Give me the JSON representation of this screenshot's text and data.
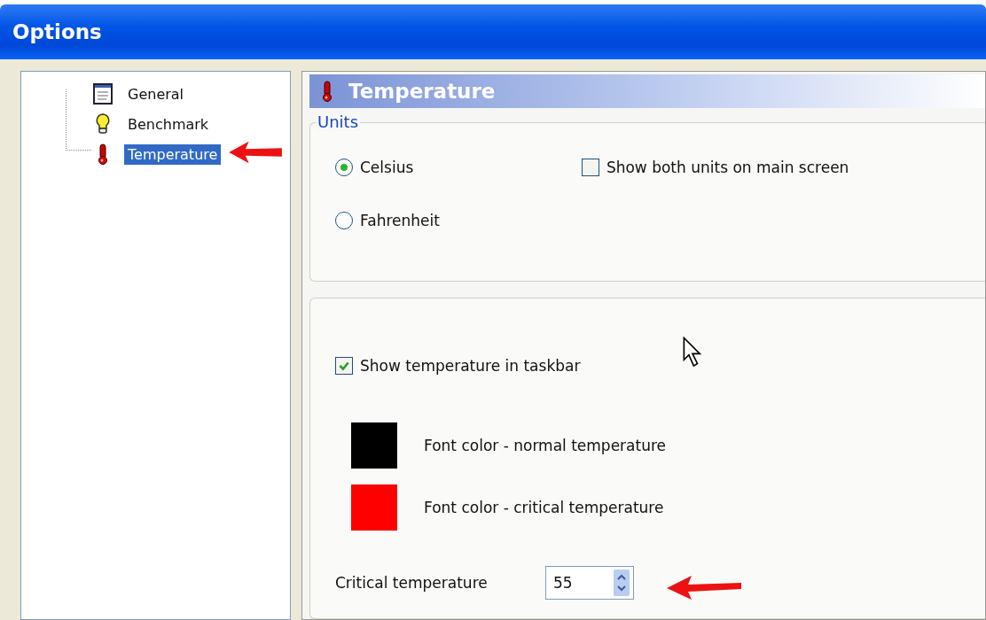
{
  "window": {
    "title": "Options"
  },
  "tree": {
    "items": [
      {
        "label": "General",
        "kind": "document",
        "selected": false
      },
      {
        "label": "Benchmark",
        "kind": "bulb",
        "selected": false
      },
      {
        "label": "Temperature",
        "kind": "thermometer",
        "selected": true
      }
    ]
  },
  "panel": {
    "title": "Temperature",
    "units_group": {
      "title": "Units",
      "options": [
        {
          "label": "Celsius",
          "selected": true
        },
        {
          "label": "Fahrenheit",
          "selected": false
        }
      ],
      "show_both": {
        "label": "Show both units on main screen",
        "checked": false
      }
    },
    "taskbar_group": {
      "show_in_taskbar": {
        "label": "Show temperature in taskbar",
        "checked": true
      },
      "font_colors": [
        {
          "label": "Font color - normal temperature",
          "color": "#000000"
        },
        {
          "label": "Font color - critical temperature",
          "color": "#ff0000"
        }
      ],
      "critical": {
        "label": "Critical temperature",
        "value": "55"
      }
    }
  }
}
